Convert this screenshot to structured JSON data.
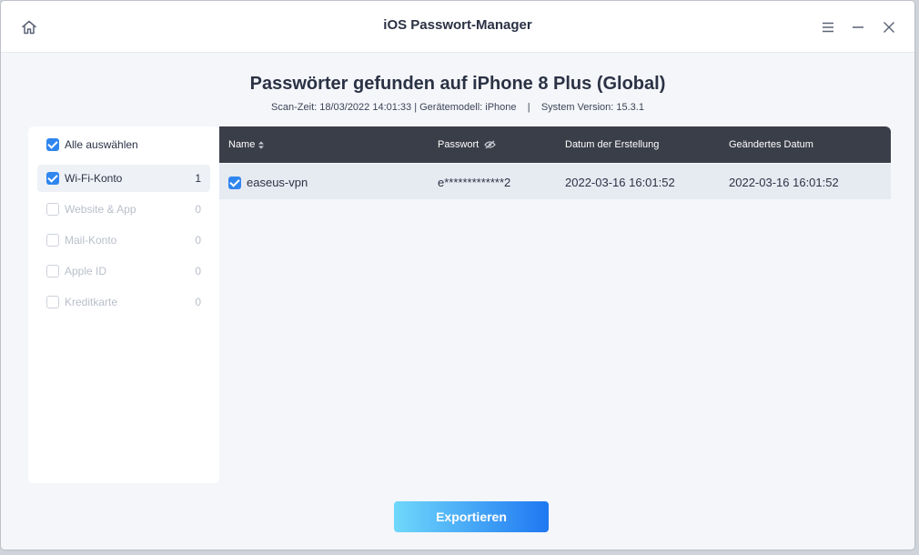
{
  "app": {
    "title": "iOS Passwort-Manager"
  },
  "heading": "Passwörter gefunden auf iPhone 8 Plus (Global)",
  "scan_info": "Scan-Zeit: 18/03/2022 14:01:33 | Gerätemodell: iPhone    |    System Version: 15.3.1",
  "sidebar": {
    "select_all_label": "Alle auswählen",
    "items": [
      {
        "label": "Wi-Fi-Konto",
        "count": "1",
        "state": "active"
      },
      {
        "label": "Website & App",
        "count": "0",
        "state": "disabled"
      },
      {
        "label": "Mail-Konto",
        "count": "0",
        "state": "disabled"
      },
      {
        "label": "Apple ID",
        "count": "0",
        "state": "disabled"
      },
      {
        "label": "Kreditkarte",
        "count": "0",
        "state": "disabled"
      }
    ]
  },
  "table": {
    "columns": [
      "Name",
      "Passwort",
      "Datum der Erstellung",
      "Geändertes Datum"
    ],
    "rows": [
      {
        "name": "easeus-vpn",
        "password": "e*************2",
        "created": "2022-03-16 16:01:52",
        "modified": "2022-03-16 16:01:52",
        "checked": true
      }
    ]
  },
  "export_label": "Exportieren",
  "colors": {
    "accent": "#2f86ef",
    "header_bg": "#3a3e48",
    "row_bg": "#e6eaf1"
  },
  "icons": [
    "home-icon",
    "menu-icon",
    "minimize-icon",
    "close-icon",
    "sort-icon",
    "eye-hidden-icon",
    "checkbox-checked-icon",
    "checkbox-empty-icon"
  ]
}
